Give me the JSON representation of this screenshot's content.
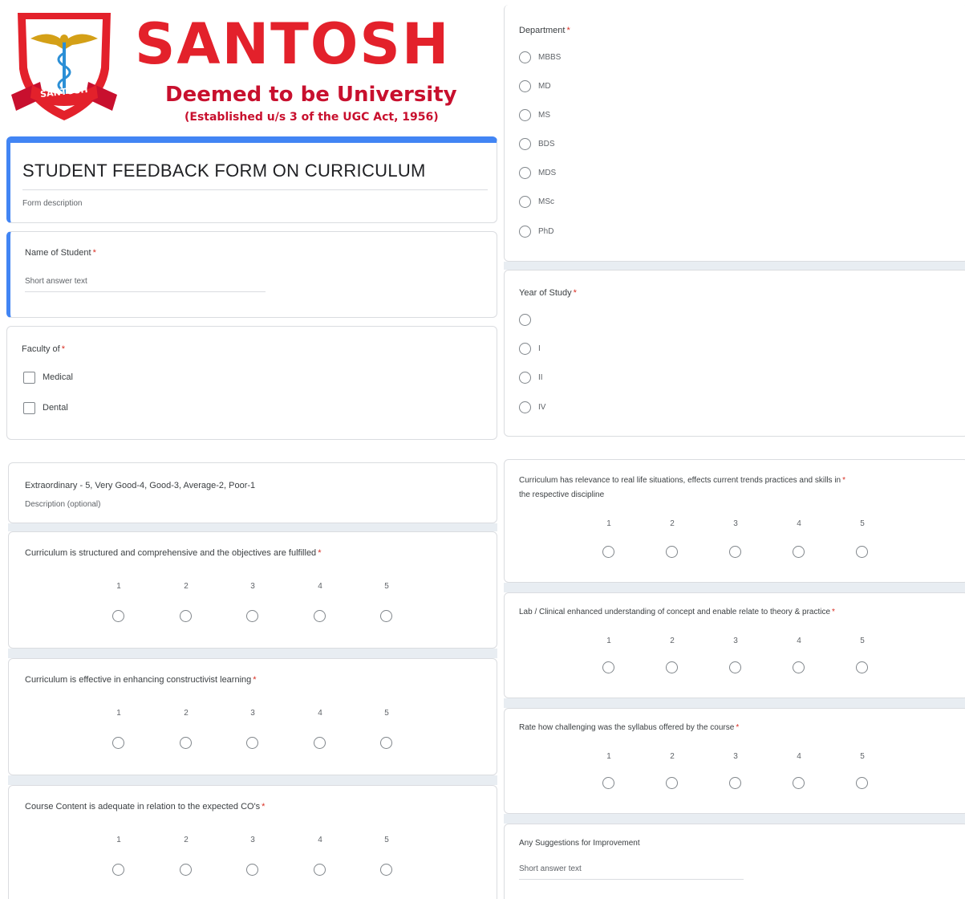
{
  "brand": {
    "name": "SANTOSH",
    "tagline": "Deemed to be University",
    "established": "(Established u/s 3 of the UGC Act, 1956)",
    "emblem_text": "SANTOSH",
    "primary_color": "#e3212b",
    "accent_color": "#4285f4"
  },
  "form": {
    "title": "STUDENT FEEDBACK FORM ON CURRICULUM",
    "description": "Form description"
  },
  "name_question": {
    "label": "Name of Student",
    "required": "*",
    "placeholder": "Short answer text"
  },
  "faculty_question": {
    "label": "Faculty of",
    "required": "*",
    "options": [
      "Medical",
      "Dental"
    ]
  },
  "department_question": {
    "label": "Department",
    "required": "*",
    "options": [
      "MBBS",
      "MD",
      "MS",
      "BDS",
      "MDS",
      "MSc",
      "PhD"
    ]
  },
  "year_question": {
    "label": "Year of Study",
    "required": "*",
    "options": [
      "",
      "I",
      "II",
      "IV"
    ]
  },
  "scale_section": {
    "title": "Extraordinary - 5, Very Good-4, Good-3, Average-2, Poor-1",
    "description": "Description (optional)"
  },
  "scale_labels": [
    "1",
    "2",
    "3",
    "4",
    "5"
  ],
  "scale_questions": [
    {
      "label": "Curriculum is structured and comprehensive and the objectives are fulfilled",
      "required": "*"
    },
    {
      "label": "Curriculum is effective in enhancing constructivist learning",
      "required": "*"
    },
    {
      "label": "Course Content is adequate in relation to the expected CO's",
      "required": "*"
    },
    {
      "label_line1": "Curriculum has relevance to real life situations, effects current trends practices and skills in",
      "label_line2": "the respective discipline",
      "required": "*"
    },
    {
      "label": "Lab / Clinical enhanced understanding of concept and enable relate to theory & practice",
      "required": "*"
    },
    {
      "label": "Rate how challenging was the syllabus offered by the course",
      "required": "*"
    }
  ],
  "suggestions": {
    "label": "Any Suggestions for Improvement",
    "placeholder": "Short answer text"
  }
}
